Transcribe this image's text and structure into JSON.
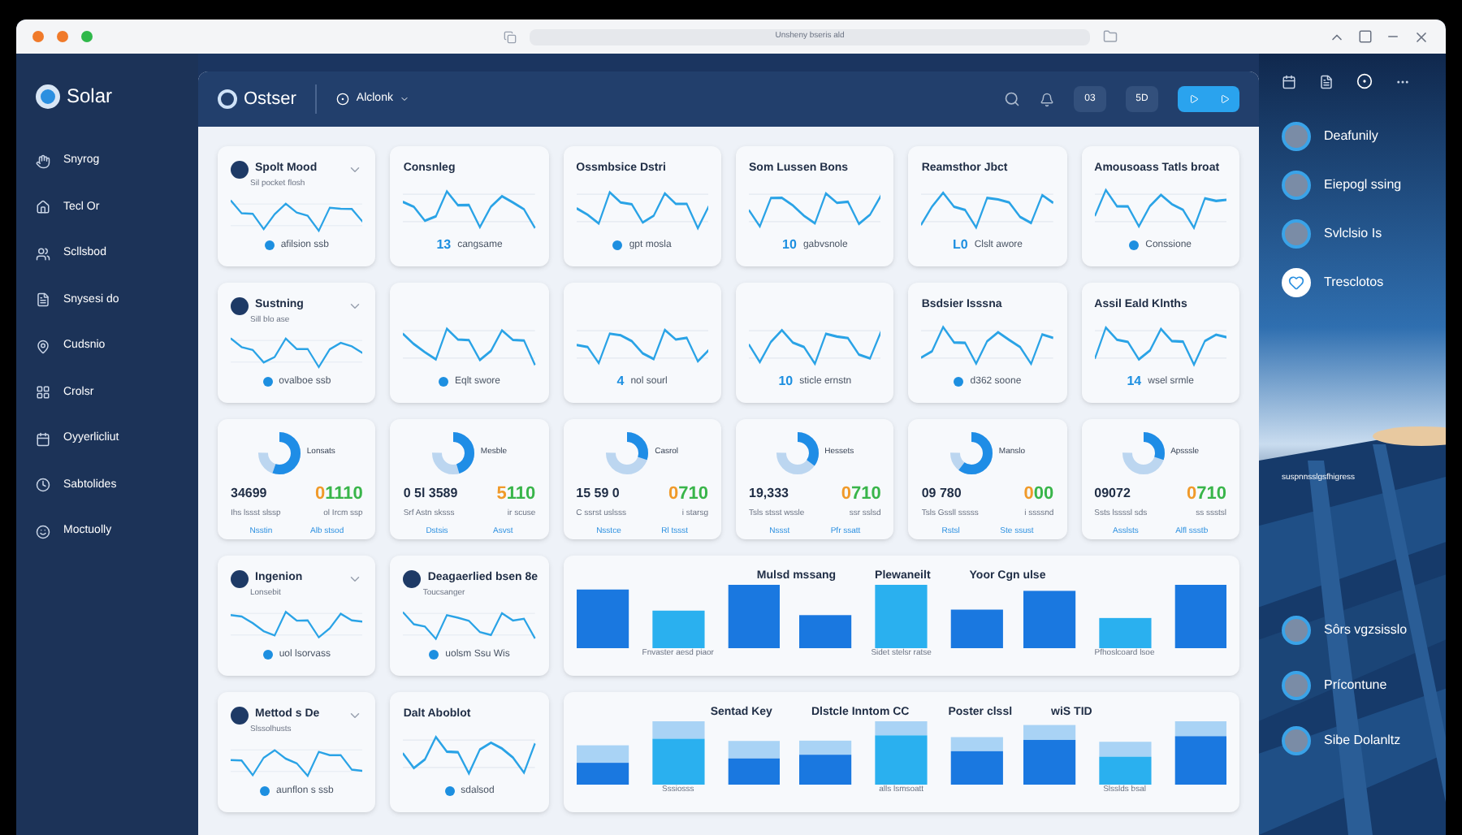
{
  "window": {
    "address": "Unsheny bseris ald"
  },
  "sidebar": {
    "logo": "Solar",
    "items": [
      {
        "label": "Snyrog"
      },
      {
        "label": "Tecl Or"
      },
      {
        "label": "Scllsbod"
      },
      {
        "label": "Snysesi do"
      },
      {
        "label": "Cudsnio"
      },
      {
        "label": "Crolsr"
      },
      {
        "label": "Oyyerlicliut"
      },
      {
        "label": "Sabtolides"
      },
      {
        "label": "Moctuolly"
      }
    ]
  },
  "header": {
    "brand": "Ostser",
    "dropdown": "Alclonk",
    "buttons": [
      "03",
      "5D"
    ]
  },
  "rows": [
    {
      "kind": "line",
      "cards": [
        {
          "title": "Spolt Mood",
          "avatar": true,
          "subtitle": "Sil pocket flosh",
          "footer": "afilsion ssb"
        },
        {
          "title": "Consnleg",
          "avatar": false,
          "footer_value": "13",
          "footer": "cangsame"
        },
        {
          "title": "Ossmbsice Dstri",
          "avatar": false,
          "footer": "gpt mosla"
        },
        {
          "title": "Som Lussen Bons",
          "avatar": false,
          "footer_value": "10",
          "footer": "gabvsnole"
        },
        {
          "title": "Reamsthor Jbct",
          "avatar": false,
          "footer_value": "L0",
          "footer": "Clslt awore"
        },
        {
          "title": "Amousoass Tatls broat",
          "avatar": false,
          "footer": "Conssione"
        }
      ]
    },
    {
      "kind": "line",
      "cards": [
        {
          "title": "Sustning",
          "avatar": true,
          "subtitle": "Sill blo ase",
          "footer": "ovalboe ssb"
        },
        {
          "avatar": false,
          "footer": "Eqlt swore"
        },
        {
          "avatar": false,
          "footer_value": "4",
          "footer": "nol sourl"
        },
        {
          "avatar": false,
          "footer_value": "10",
          "footer": "sticle ernstn"
        },
        {
          "title": "Bsdsier Isssna",
          "avatar": false,
          "footer": "d362 soone"
        },
        {
          "title": "Assil Eald Klnths",
          "avatar": false,
          "footer_value": "14",
          "footer": "wsel srmle"
        }
      ]
    },
    {
      "kind": "metric",
      "cards": [
        {
          "label": "Lonsats",
          "value_a": "34699",
          "accent": "0",
          "value_b": "1110",
          "caption_a": "Ihs lssst slssp",
          "caption_b": "ol Ircm ssp",
          "link_a": "Nsstin",
          "link_b": "Alb stsod"
        },
        {
          "label": "Mesble",
          "value_a": "0 5l 3589",
          "accent": "5",
          "value_b": "110",
          "caption_a": "Srf Astn sksss",
          "caption_b": "ir scuse",
          "link_a": "Dstsis",
          "link_b": "Asvst"
        },
        {
          "label": "Casrol",
          "value_a": "15 59 0",
          "accent": "0",
          "value_b": "710",
          "caption_a": "C ssrst uslsss",
          "caption_b": "i starsg",
          "link_a": "Nsstce",
          "link_b": "Rl tssst"
        },
        {
          "label": "Hessets",
          "value_a": "19,333",
          "accent": "0",
          "value_b": "710",
          "caption_a": "Tsls stsst wssle",
          "caption_b": "ssr sslsd",
          "link_a": "Nssst",
          "link_b": "Pfr ssatt"
        },
        {
          "label": "Manslo",
          "value_a": "09 780",
          "accent": "0",
          "value_b": "00",
          "caption_a": "Tsls Gssll sssss",
          "caption_b": "i ssssnd",
          "link_a": "Rstsl",
          "link_b": "Ste ssust"
        },
        {
          "label": "Apsssle",
          "value_a": "09072",
          "accent": "0",
          "value_b": "710",
          "caption_a": "Ssts lssssl sds",
          "caption_b": "ss ssstsl",
          "link_a": "Asslsts",
          "link_b": "Alfl ssstb"
        }
      ]
    },
    {
      "kind": "mixed",
      "cards": [
        {
          "title": "Ingenion",
          "avatar": true,
          "subtitle": "Lonsebit",
          "footer": "uol lsorvass"
        },
        {
          "title": "Deagaerlied bsen 8e",
          "avatar": true,
          "subtitle": "Toucsanger",
          "footer": "uolsm Ssu Wis"
        }
      ],
      "wide": {
        "headings": [
          "Mulsd mssang",
          "Plewaneilt",
          "Yoor Cgn ulse"
        ],
        "captions": [
          "Fnvaster aesd piaor",
          "Sidet stelsr ratse",
          "Pfhoslcoard lsoe"
        ],
        "stacked": false
      }
    },
    {
      "kind": "mixed",
      "cards": [
        {
          "title": "Mettod s De",
          "avatar": true,
          "subtitle": "Slssolhusts",
          "footer": "aunflon s ssb"
        },
        {
          "title": "Dalt Aboblot",
          "avatar": false,
          "footer": "sdalsod"
        }
      ],
      "wide": {
        "headings": [
          "Sentad Key",
          "Dlstcle Inntom CC",
          "Poster clssl",
          "wiS TID"
        ],
        "captions": [
          "Sssiosss",
          "alls lsmsoatt",
          "Slsslds bsal"
        ],
        "stacked": true
      }
    }
  ],
  "right_panel": {
    "people": [
      {
        "name": "Deafunily",
        "kind": "avatar"
      },
      {
        "name": "Eiepogl ssing",
        "kind": "avatar"
      },
      {
        "name": "Svlclsio Is",
        "kind": "avatar"
      },
      {
        "name": "Tresclotos",
        "kind": "heart"
      }
    ],
    "caption": "suspnnsslgsfhigress",
    "people_bottom": [
      {
        "name": "Sôrs vgzsisslo"
      },
      {
        "name": "Prícontune"
      },
      {
        "name": "Sibe Dolanltz"
      }
    ]
  }
}
